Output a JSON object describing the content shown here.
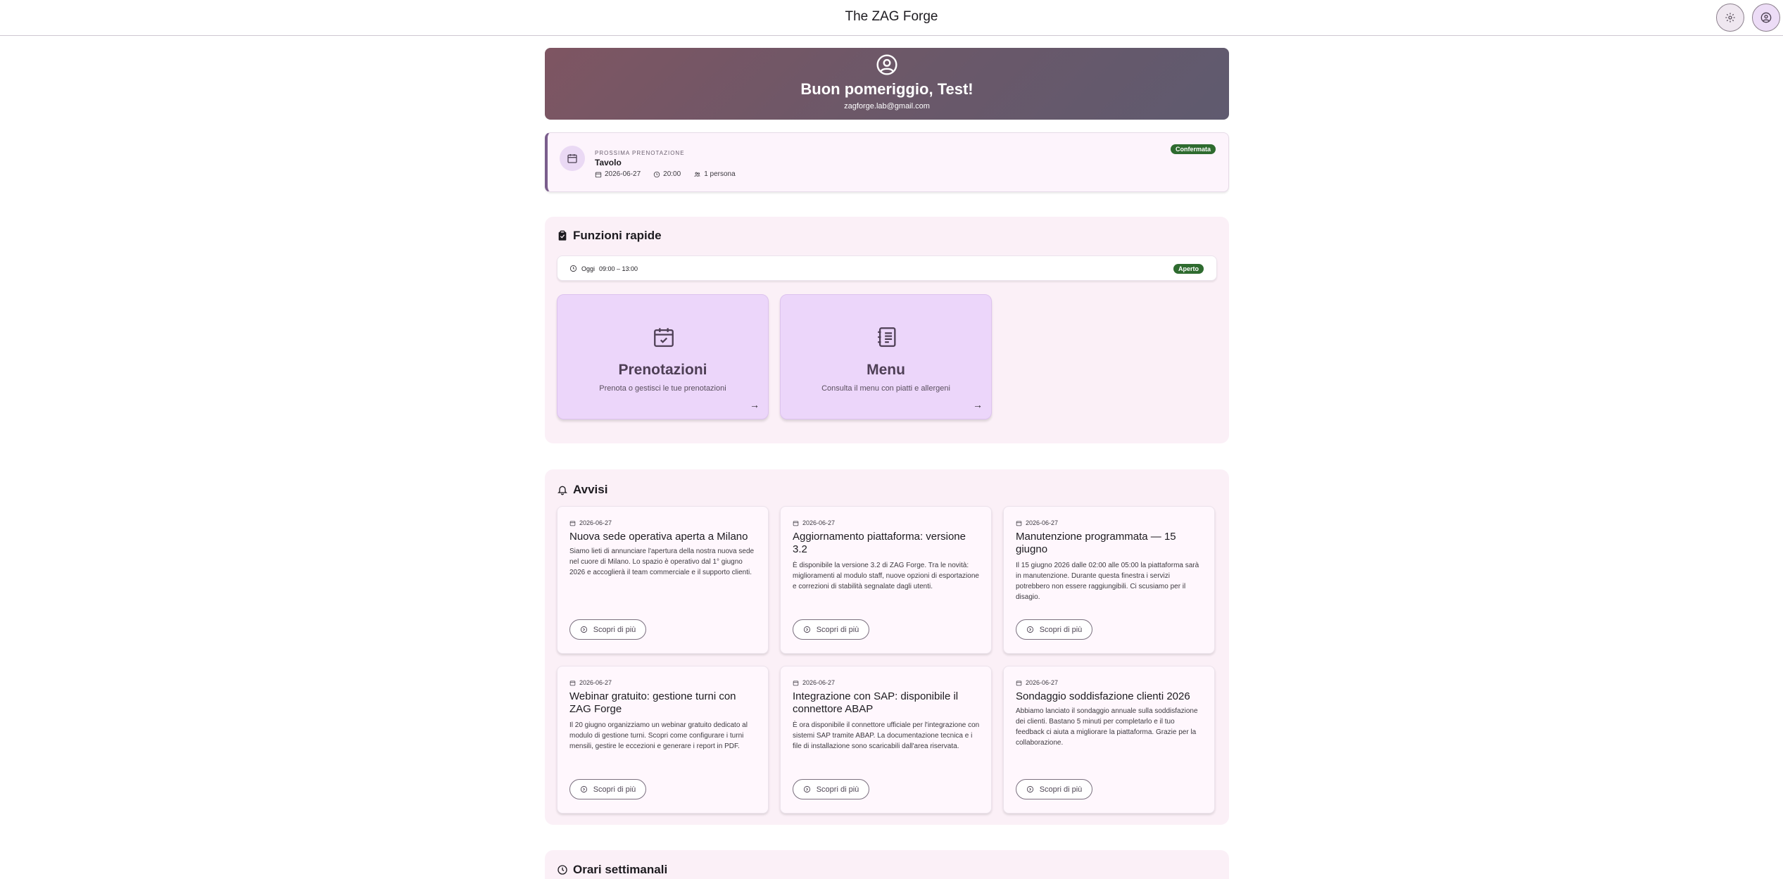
{
  "app": {
    "title": "The ZAG Forge"
  },
  "header": {
    "settings_icon": "gear-icon",
    "account_icon": "account-icon"
  },
  "hero": {
    "greeting": "Buon pomeriggio, Test!",
    "email": "zagforge.lab@gmail.com"
  },
  "booking": {
    "kicker": "PROSSIMA PRENOTAZIONE",
    "type": "Tavolo",
    "date": "2026-06-27",
    "time": "20:00",
    "people": "1 persona",
    "status": "Confermata"
  },
  "quick": {
    "title": "Funzioni rapide",
    "hours_label": "Oggi",
    "hours_value": "09:00 – 13:00",
    "hours_status": "Aperto",
    "tiles": [
      {
        "name": "Prenotazioni",
        "desc": "Prenota o gestisci le tue prenotazioni",
        "arrow": "→"
      },
      {
        "name": "Menu",
        "desc": "Consulta il menu con piatti e allergeni",
        "arrow": "→"
      }
    ]
  },
  "notices": {
    "title": "Avvisi",
    "more_label": "Scopri di più",
    "items": [
      {
        "date": "2026-06-27",
        "title": "Nuova sede operativa aperta a Milano",
        "body": "Siamo lieti di annunciare l'apertura della nostra nuova sede nel cuore di Milano. Lo spazio è operativo dal 1° giugno 2026 e accoglierà il team commerciale e il supporto clienti."
      },
      {
        "date": "2026-06-27",
        "title": "Aggiornamento piattaforma: versione 3.2",
        "body": "È disponibile la versione 3.2 di ZAG Forge. Tra le novità: miglioramenti al modulo staff, nuove opzioni di esportazione e correzioni di stabilità segnalate dagli utenti."
      },
      {
        "date": "2026-06-27",
        "title": "Manutenzione programmata — 15 giugno",
        "body": "Il 15 giugno 2026 dalle 02:00 alle 05:00 la piattaforma sarà in manutenzione. Durante questa finestra i servizi potrebbero non essere raggiungibili. Ci scusiamo per il disagio."
      },
      {
        "date": "2026-06-27",
        "title": "Webinar gratuito: gestione turni con ZAG Forge",
        "body": "Il 20 giugno organizziamo un webinar gratuito dedicato al modulo di gestione turni. Scopri come configurare i turni mensili, gestire le eccezioni e generare i report in PDF."
      },
      {
        "date": "2026-06-27",
        "title": "Integrazione con SAP: disponibile il connettore ABAP",
        "body": "È ora disponibile il connettore ufficiale per l'integrazione con sistemi SAP tramite ABAP. La documentazione tecnica e i file di installazione sono scaricabili dall'area riservata."
      },
      {
        "date": "2026-06-27",
        "title": "Sondaggio soddisfazione clienti 2026",
        "body": "Abbiamo lanciato il sondaggio annuale sulla soddisfazione dei clienti. Bastano 5 minuti per completarlo e il tuo feedback ci aiuta a migliorare la piattaforma. Grazie per la collaborazione."
      }
    ]
  },
  "weekly": {
    "title": "Orari settimanali"
  },
  "colors": {
    "accent": "#7a5d8c",
    "badge_green": "#2e6b2f",
    "tile": "#ecd6fa",
    "section_bg": "#fbf0f7"
  }
}
